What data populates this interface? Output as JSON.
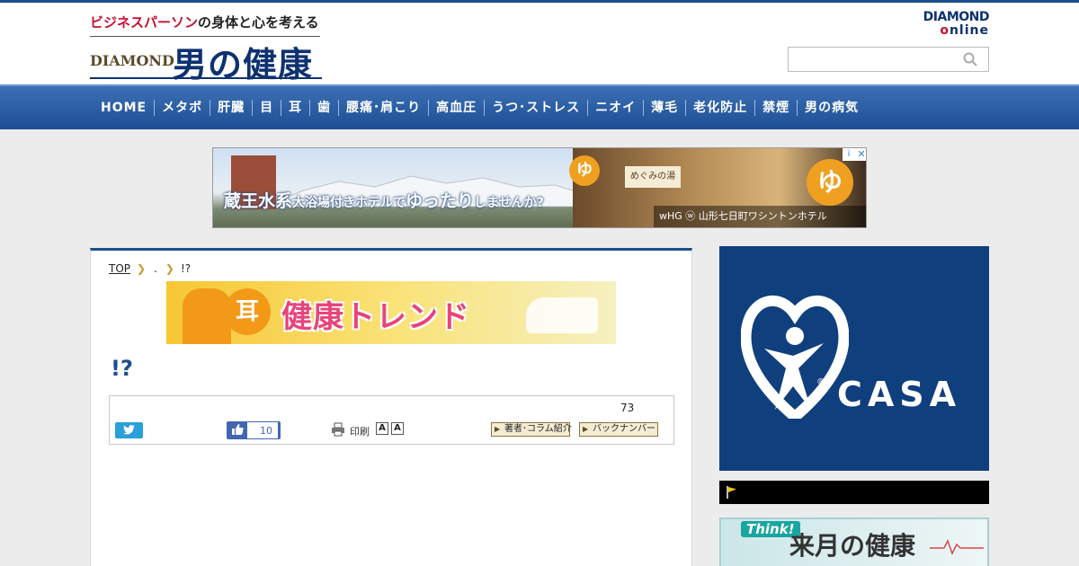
{
  "header": {
    "tagline_highlight": "ビジネスパーソン",
    "tagline_rest": "の身体と心を考える",
    "brand": "DIAMOND",
    "site_title": "男の健康",
    "online_logo_line1": "DIAMOND",
    "online_logo_o": "o",
    "online_logo_rest": "nline",
    "search_placeholder": ""
  },
  "nav": {
    "items": [
      "HOME",
      "メタボ",
      "肝臓",
      "目",
      "耳",
      "歯",
      "腰痛･肩こり",
      "高血圧",
      "うつ･ストレス",
      "ニオイ",
      "薄毛",
      "老化防止",
      "禁煙",
      "男の病気"
    ]
  },
  "ad": {
    "headline_1": "蔵王水系",
    "headline_2": "大浴場",
    "headline_3": "付きホテルで",
    "headline_4": "ゆったり",
    "headline_5": "しませんか?",
    "sign": "めぐみの湯",
    "yu": "ゆ",
    "footer": "wHG ⓦ 山形七日町ワシントンホテル",
    "info_icon": "i",
    "close_icon": "✕"
  },
  "breadcrumb": {
    "top": "TOP",
    "mid": ".",
    "current": "!?"
  },
  "trend_banner": {
    "ear": "耳",
    "title": "健康トレンド"
  },
  "article": {
    "headline": "!?",
    "share_count": "73",
    "fb_count": "10",
    "print_label": "印刷",
    "font_small": "A",
    "font_large": "A",
    "author_button": "著者･コラム紹介",
    "backnumber_button": "バックナンバー",
    "lead": "",
    "body": ""
  },
  "sidebar": {
    "casa": "CASA",
    "registered": "®",
    "think": "Think!",
    "next_health": "来月の健康"
  },
  "colors": {
    "brand_blue": "#1d4f8c",
    "accent_red": "#c8102e",
    "nav_blue": "#2c5fa6"
  }
}
